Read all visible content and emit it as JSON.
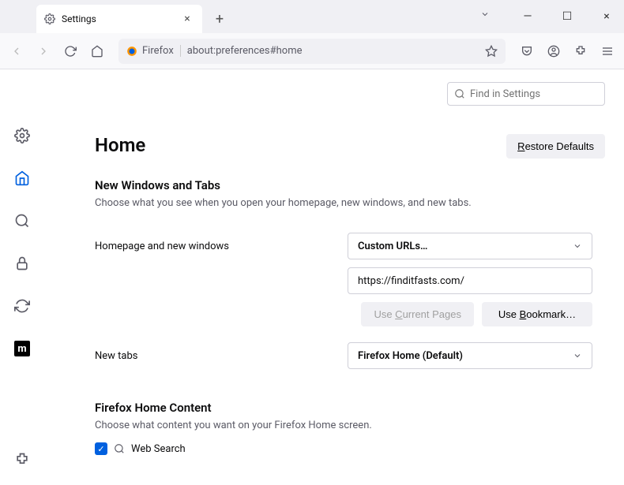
{
  "tab": {
    "title": "Settings"
  },
  "urlbar": {
    "identity": "Firefox",
    "address": "about:preferences#home"
  },
  "find": {
    "placeholder": "Find in Settings"
  },
  "page": {
    "title": "Home",
    "restore_btn_prefix": "R",
    "restore_btn_rest": "estore Defaults"
  },
  "section_newwin": {
    "title": "New Windows and Tabs",
    "desc": "Choose what you see when you open your homepage, new windows, and new tabs."
  },
  "homepage_row": {
    "label": "Homepage and new windows",
    "select_value": "Custom URLs…",
    "url_value": "https://finditfasts.com/"
  },
  "buttons": {
    "use_current_pre": "Use ",
    "use_current_u": "C",
    "use_current_post": "urrent Pages",
    "use_bookmark_pre": "Use ",
    "use_bookmark_u": "B",
    "use_bookmark_post": "ookmark…"
  },
  "newtabs_row": {
    "label": "New tabs",
    "select_value": "Firefox Home (Default)"
  },
  "section_home_content": {
    "title": "Firefox Home Content",
    "desc": "Choose what content you want on your Firefox Home screen.",
    "web_search": "Web Search"
  }
}
